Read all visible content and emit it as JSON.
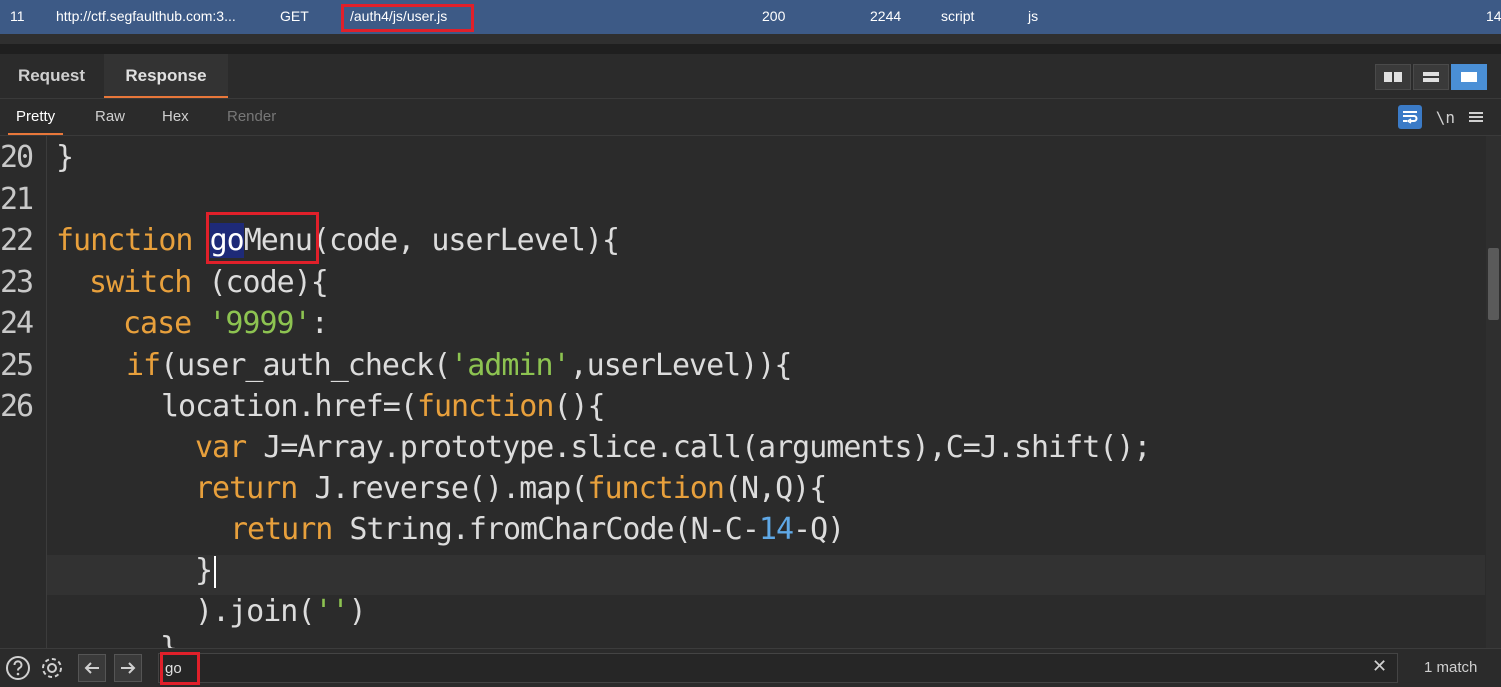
{
  "history_row": {
    "index": "11",
    "host": "http://ctf.segfaulthub.com:3...",
    "method": "GET",
    "url": "/auth4/js/user.js",
    "status": "200",
    "length": "2244",
    "mime": "script",
    "extension": "js",
    "tail": "14"
  },
  "tabs": {
    "request": "Request",
    "response": "Response"
  },
  "subtabs": {
    "pretty": "Pretty",
    "raw": "Raw",
    "hex": "Hex",
    "render": "Render"
  },
  "newline_toggle": "\\n",
  "code": {
    "line_numbers": [
      "20",
      "21",
      "22",
      "23",
      "24",
      "25",
      "26"
    ],
    "l20": "}",
    "l22_kw": "function",
    "l22_match": "go",
    "l22_name": "Menu",
    "l22_rest": "(code, userLevel){",
    "l23_kw": "switch",
    "l23_rest": " (code){",
    "l24_kw": "case",
    "l24_str": "'9999'",
    "l24_rest": ":",
    "l25_kw": "if",
    "l25_a": "(user_auth_check(",
    "l25_str": "'admin'",
    "l25_b": ",userLevel)){",
    "l26_a": "location.href=(",
    "l26_kw": "function",
    "l26_b": "(){",
    "w1_kw": "var",
    "w1_rest": " J=Array.prototype.slice.call(arguments),C=J.shift();",
    "w2_kw": "return",
    "w2_a": " J.reverse().map(",
    "w2_kw2": "function",
    "w2_b": "(N,Q){",
    "w3_kw": "return",
    "w3_a": " String.fromCharCode(N-C-",
    "w3_num": "14",
    "w3_b": "-Q)",
    "w4": "}",
    "w5_a": ").join(",
    "w5_str": "''",
    "w5_b": ")",
    "w6": "}"
  },
  "search": {
    "value": "go",
    "match_count": "1 match"
  },
  "colors": {
    "accent": "#e8773a",
    "selected_row": "#3d5a86",
    "keyword": "#e8a03c",
    "string": "#8dc351",
    "number": "#5fa8e6",
    "highlight": "#e0202a"
  }
}
